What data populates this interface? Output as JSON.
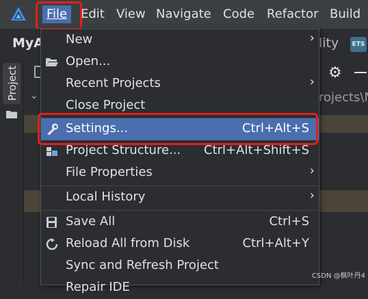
{
  "menubar": {
    "items": [
      "File",
      "Edit",
      "View",
      "Navigate",
      "Code",
      "Refactor",
      "Build"
    ],
    "active": "File"
  },
  "toolbar": {
    "project_name": "MyA",
    "right_text": "lity",
    "badge": "ETS"
  },
  "left_panel": {
    "project_tab": "Project"
  },
  "editor": {
    "path_text": "rojects\\M"
  },
  "file_menu": {
    "items": [
      {
        "label": "New",
        "submenu": true
      },
      {
        "label": "Open...",
        "icon": "folder-open-icon"
      },
      {
        "label": "Recent Projects",
        "submenu": true
      },
      {
        "label": "Close Project"
      },
      {
        "label": "Settings...",
        "shortcut": "Ctrl+Alt+S",
        "icon": "wrench-icon",
        "selected": true
      },
      {
        "label": "Project Structure...",
        "shortcut": "Ctrl+Alt+Shift+S",
        "icon": "project-structure-icon"
      },
      {
        "label": "File Properties",
        "submenu": true
      },
      {
        "label": "Local History",
        "submenu": true
      },
      {
        "label": "Save All",
        "shortcut": "Ctrl+S",
        "icon": "save-icon"
      },
      {
        "label": "Reload All from Disk",
        "shortcut": "Ctrl+Alt+Y",
        "icon": "reload-icon"
      },
      {
        "label": "Sync and Refresh Project"
      },
      {
        "label": "Repair IDE"
      }
    ]
  },
  "watermark": "CSDN @枫叶丹4",
  "colors": {
    "selection": "#4b6eaf",
    "highlight_box": "#e02020"
  }
}
